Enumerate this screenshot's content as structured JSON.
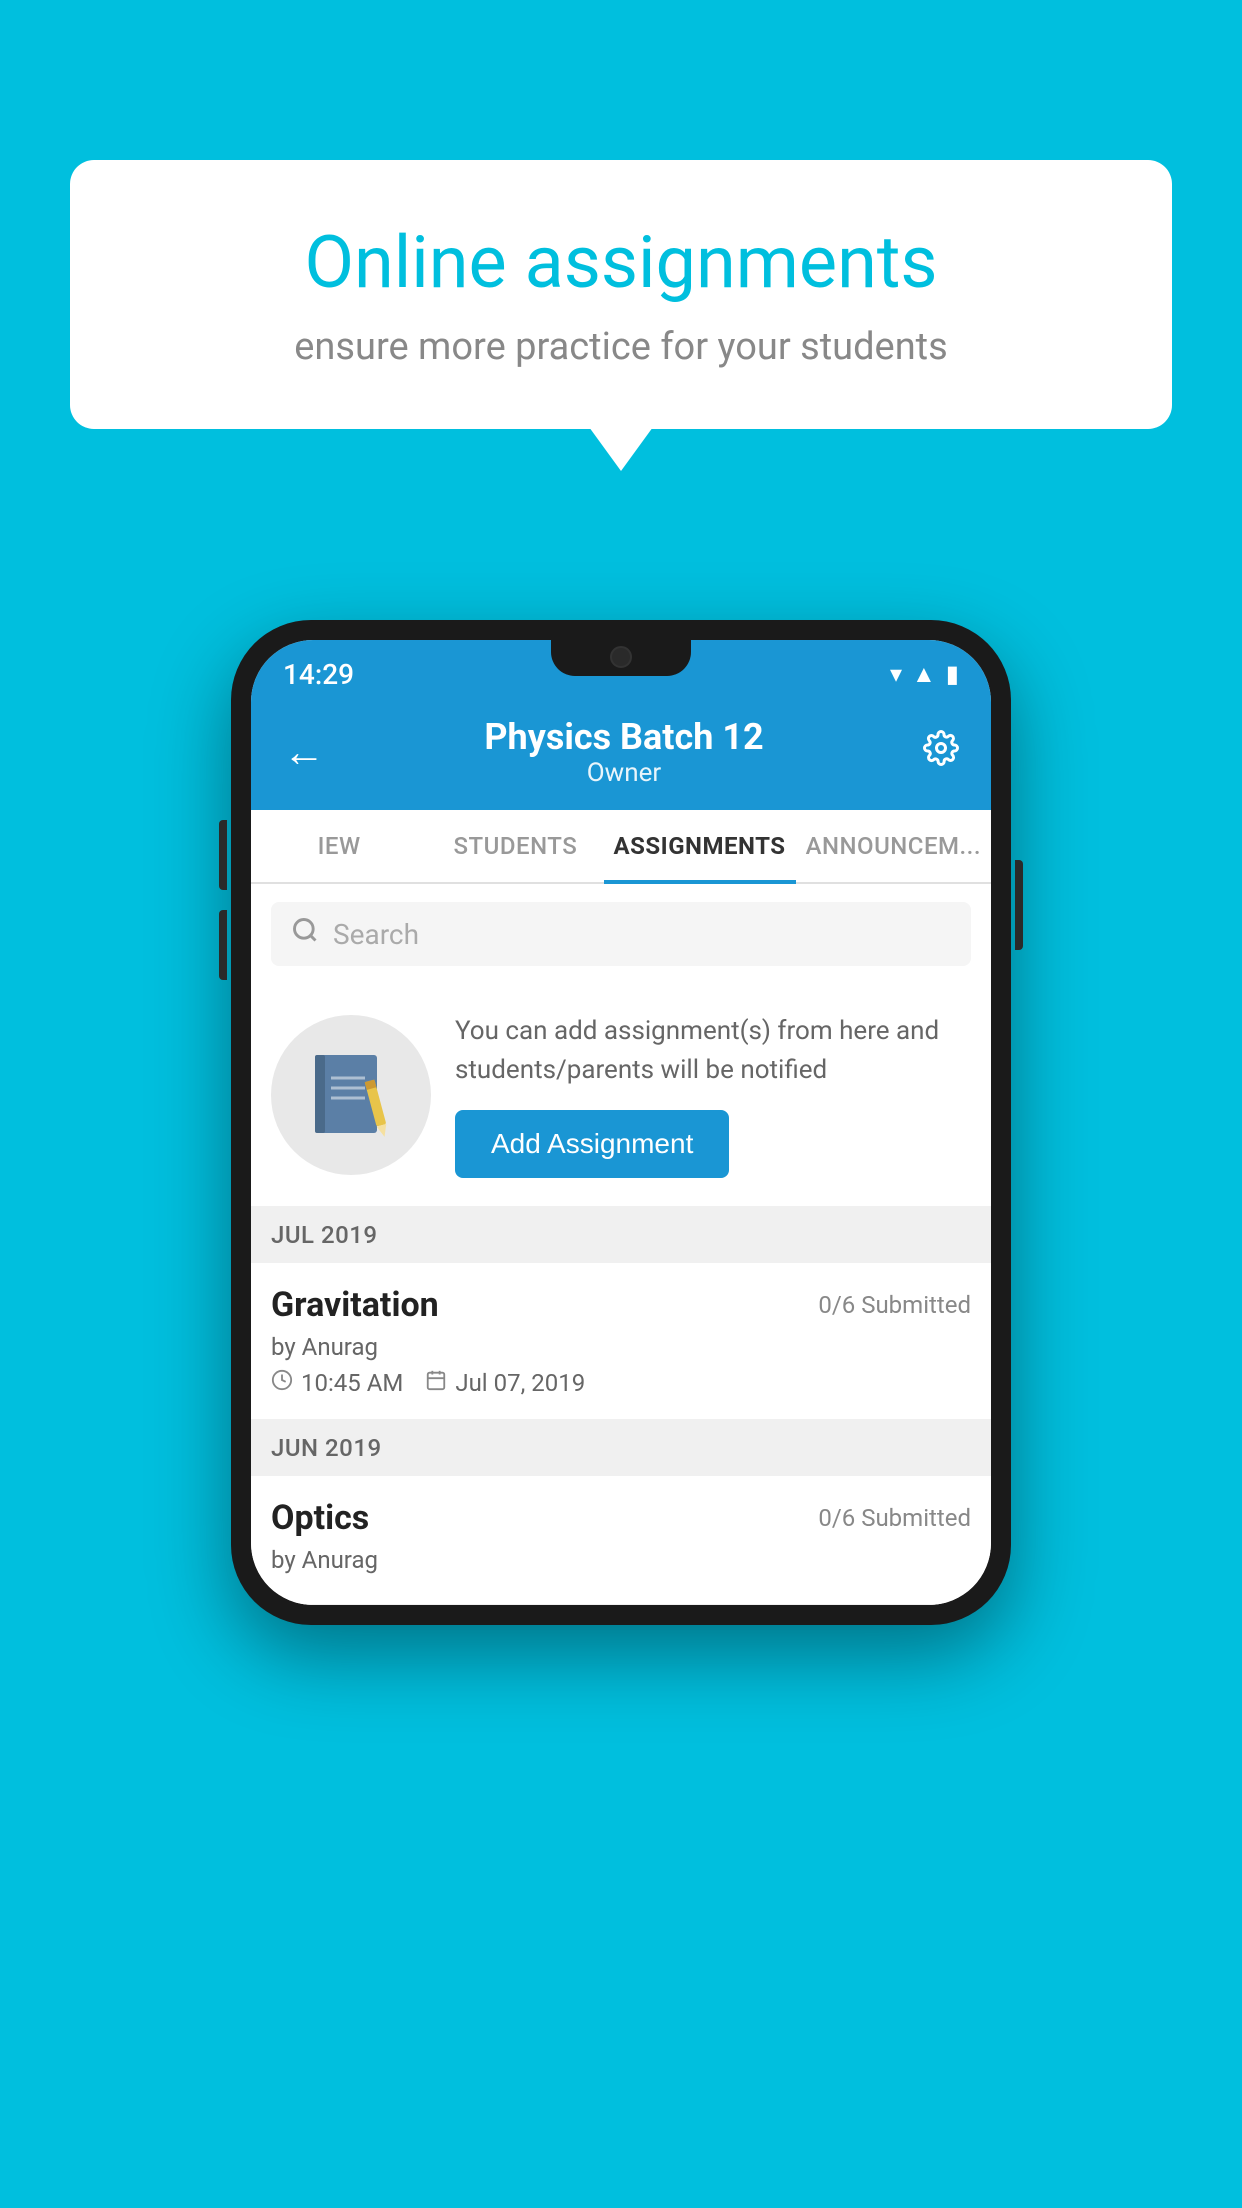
{
  "background": {
    "color": "#00BFDE"
  },
  "speechBubble": {
    "title": "Online assignments",
    "subtitle": "ensure more practice for your students"
  },
  "statusBar": {
    "time": "14:29",
    "icons": [
      "wifi",
      "signal",
      "battery"
    ]
  },
  "header": {
    "title": "Physics Batch 12",
    "subtitle": "Owner",
    "backLabel": "←",
    "settingsLabel": "⚙"
  },
  "tabs": [
    {
      "label": "IEW",
      "active": false
    },
    {
      "label": "STUDENTS",
      "active": false
    },
    {
      "label": "ASSIGNMENTS",
      "active": true
    },
    {
      "label": "ANNOUNCEM...",
      "active": false
    }
  ],
  "search": {
    "placeholder": "Search"
  },
  "addAssignment": {
    "description": "You can add assignment(s) from here and students/parents will be notified",
    "buttonLabel": "Add Assignment"
  },
  "sections": [
    {
      "month": "JUL 2019",
      "assignments": [
        {
          "name": "Gravitation",
          "submitted": "0/6 Submitted",
          "author": "by Anurag",
          "time": "10:45 AM",
          "date": "Jul 07, 2019"
        }
      ]
    },
    {
      "month": "JUN 2019",
      "assignments": [
        {
          "name": "Optics",
          "submitted": "0/6 Submitted",
          "author": "by Anurag",
          "time": "",
          "date": ""
        }
      ]
    }
  ]
}
